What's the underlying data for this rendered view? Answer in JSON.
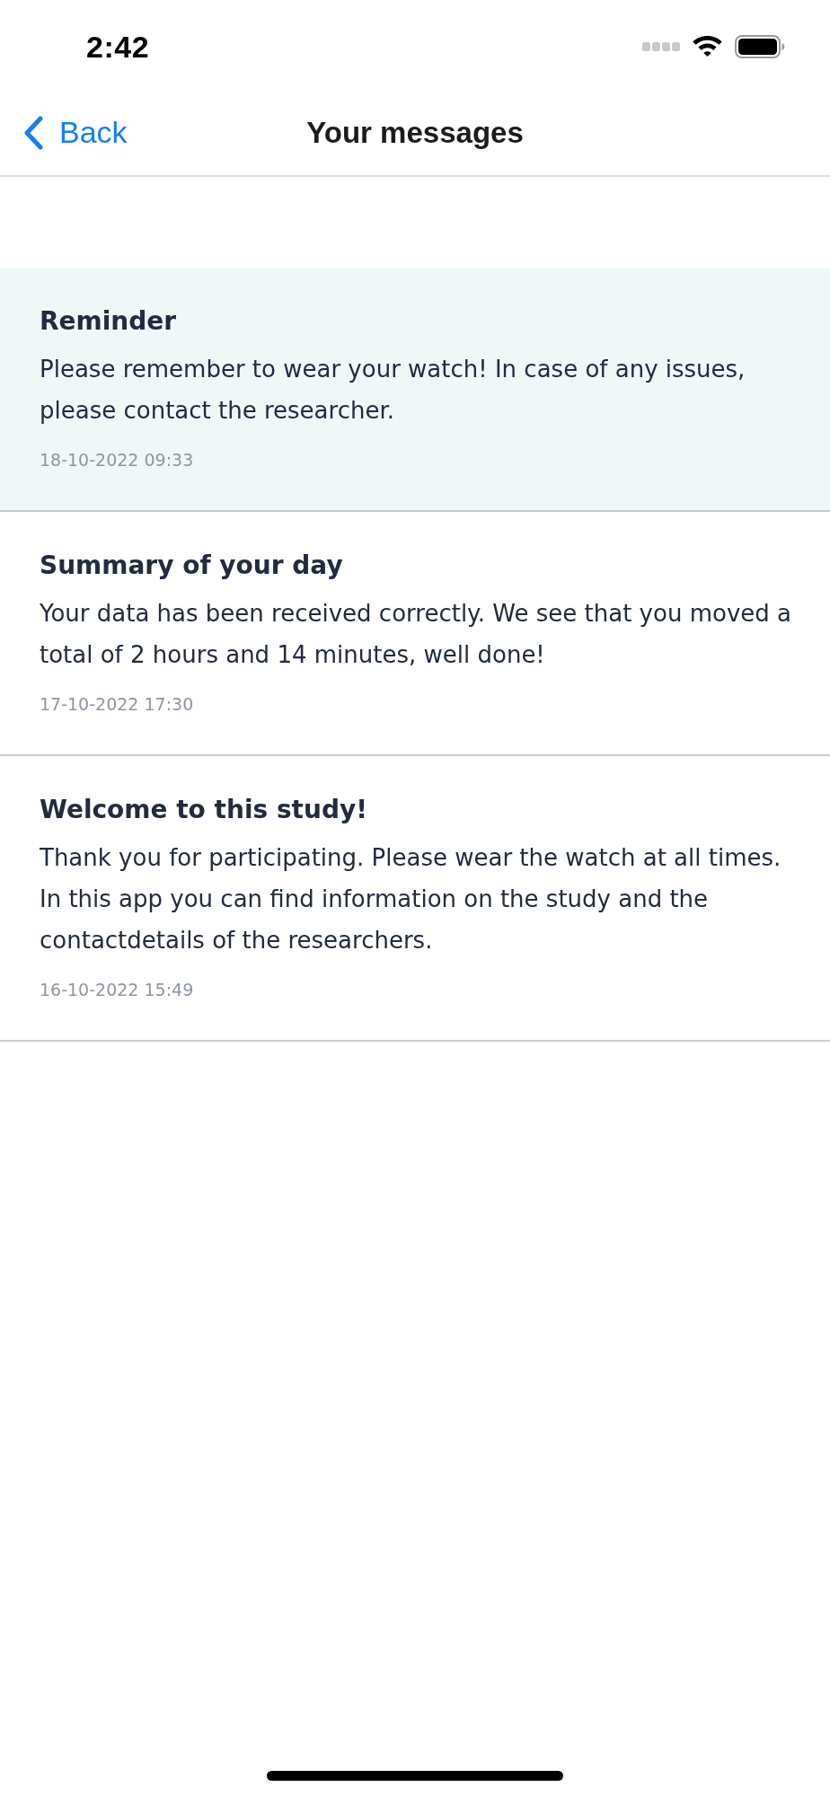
{
  "status_bar": {
    "time": "2:42"
  },
  "nav_bar": {
    "back_label": "Back",
    "title": "Your messages"
  },
  "messages": [
    {
      "title": "Reminder",
      "body": "Please remember to wear your watch! In case of any issues, please contact the researcher.",
      "date": "18-10-2022 09:33",
      "unread": true
    },
    {
      "title": "Summary of your day",
      "body": "Your data has been received correctly. We see that you moved a total of 2 hours and 14 minutes, well done!",
      "date": "17-10-2022 17:30",
      "unread": false
    },
    {
      "title": "Welcome to this study!",
      "body": "Thank you for participating. Please wear the watch at all times. In this app you can find information on the study and the contactdetails of the researchers.",
      "date": "16-10-2022 15:49",
      "unread": false
    }
  ]
}
